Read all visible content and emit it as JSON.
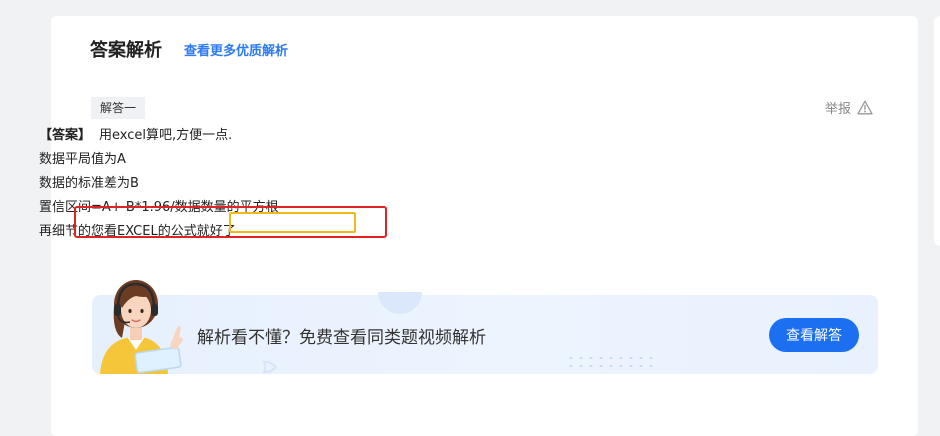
{
  "header": {
    "title": "答案解析",
    "more_link": "查看更多优质解析"
  },
  "answer": {
    "tag": "解答一",
    "report_label": "举报",
    "label": "【答案】",
    "lines": [
      "用excel算吧,方便一点.",
      "数据平局值为A",
      "数据的标准差为B",
      "置信区间=A+-B*1.96/",
      "数据数量的平方根",
      "再细节的您看EXCEL的公式就好了"
    ]
  },
  "banner": {
    "text": "解析看不懂？免费查看同类题视频解析",
    "button": "查看解答"
  },
  "colors": {
    "accent": "#1d6ff2",
    "link": "#2f7bf0",
    "highlight_red": "#e02424",
    "highlight_yellow": "#f2b81c"
  }
}
